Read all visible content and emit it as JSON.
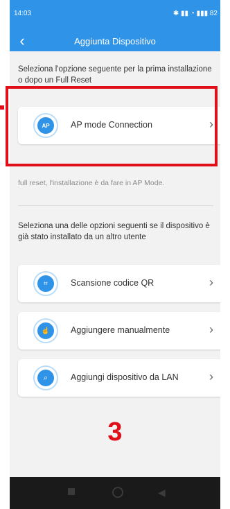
{
  "status_bar": {
    "time": "14:03",
    "icons_text": "✱ ▮▮ ◔ ▮▮▮ 82"
  },
  "header": {
    "title": "Aggiunta Dispositivo"
  },
  "section1": {
    "intro": "Seleziona l'opzione seguente per la prima installazione o dopo un Full Reset",
    "ap_card": {
      "label": "AP mode Connection",
      "icon_text": "AP"
    },
    "note": "full reset, l'installazione è da fare in AP Mode."
  },
  "section2": {
    "intro": "Seleziona una delle opzioni seguenti se il dispositivo è già stato installato da un altro utente",
    "options": [
      {
        "label": "Scansione codice QR",
        "icon": "qr-scan-icon"
      },
      {
        "label": "Aggiungere manualmente",
        "icon": "hand-tap-icon"
      },
      {
        "label": "Aggiungi dispositivo da LAN",
        "icon": "search-icon"
      }
    ]
  },
  "annotation": {
    "step": "3"
  },
  "colors": {
    "accent": "#2f93e8",
    "highlight": "#e0101a"
  }
}
